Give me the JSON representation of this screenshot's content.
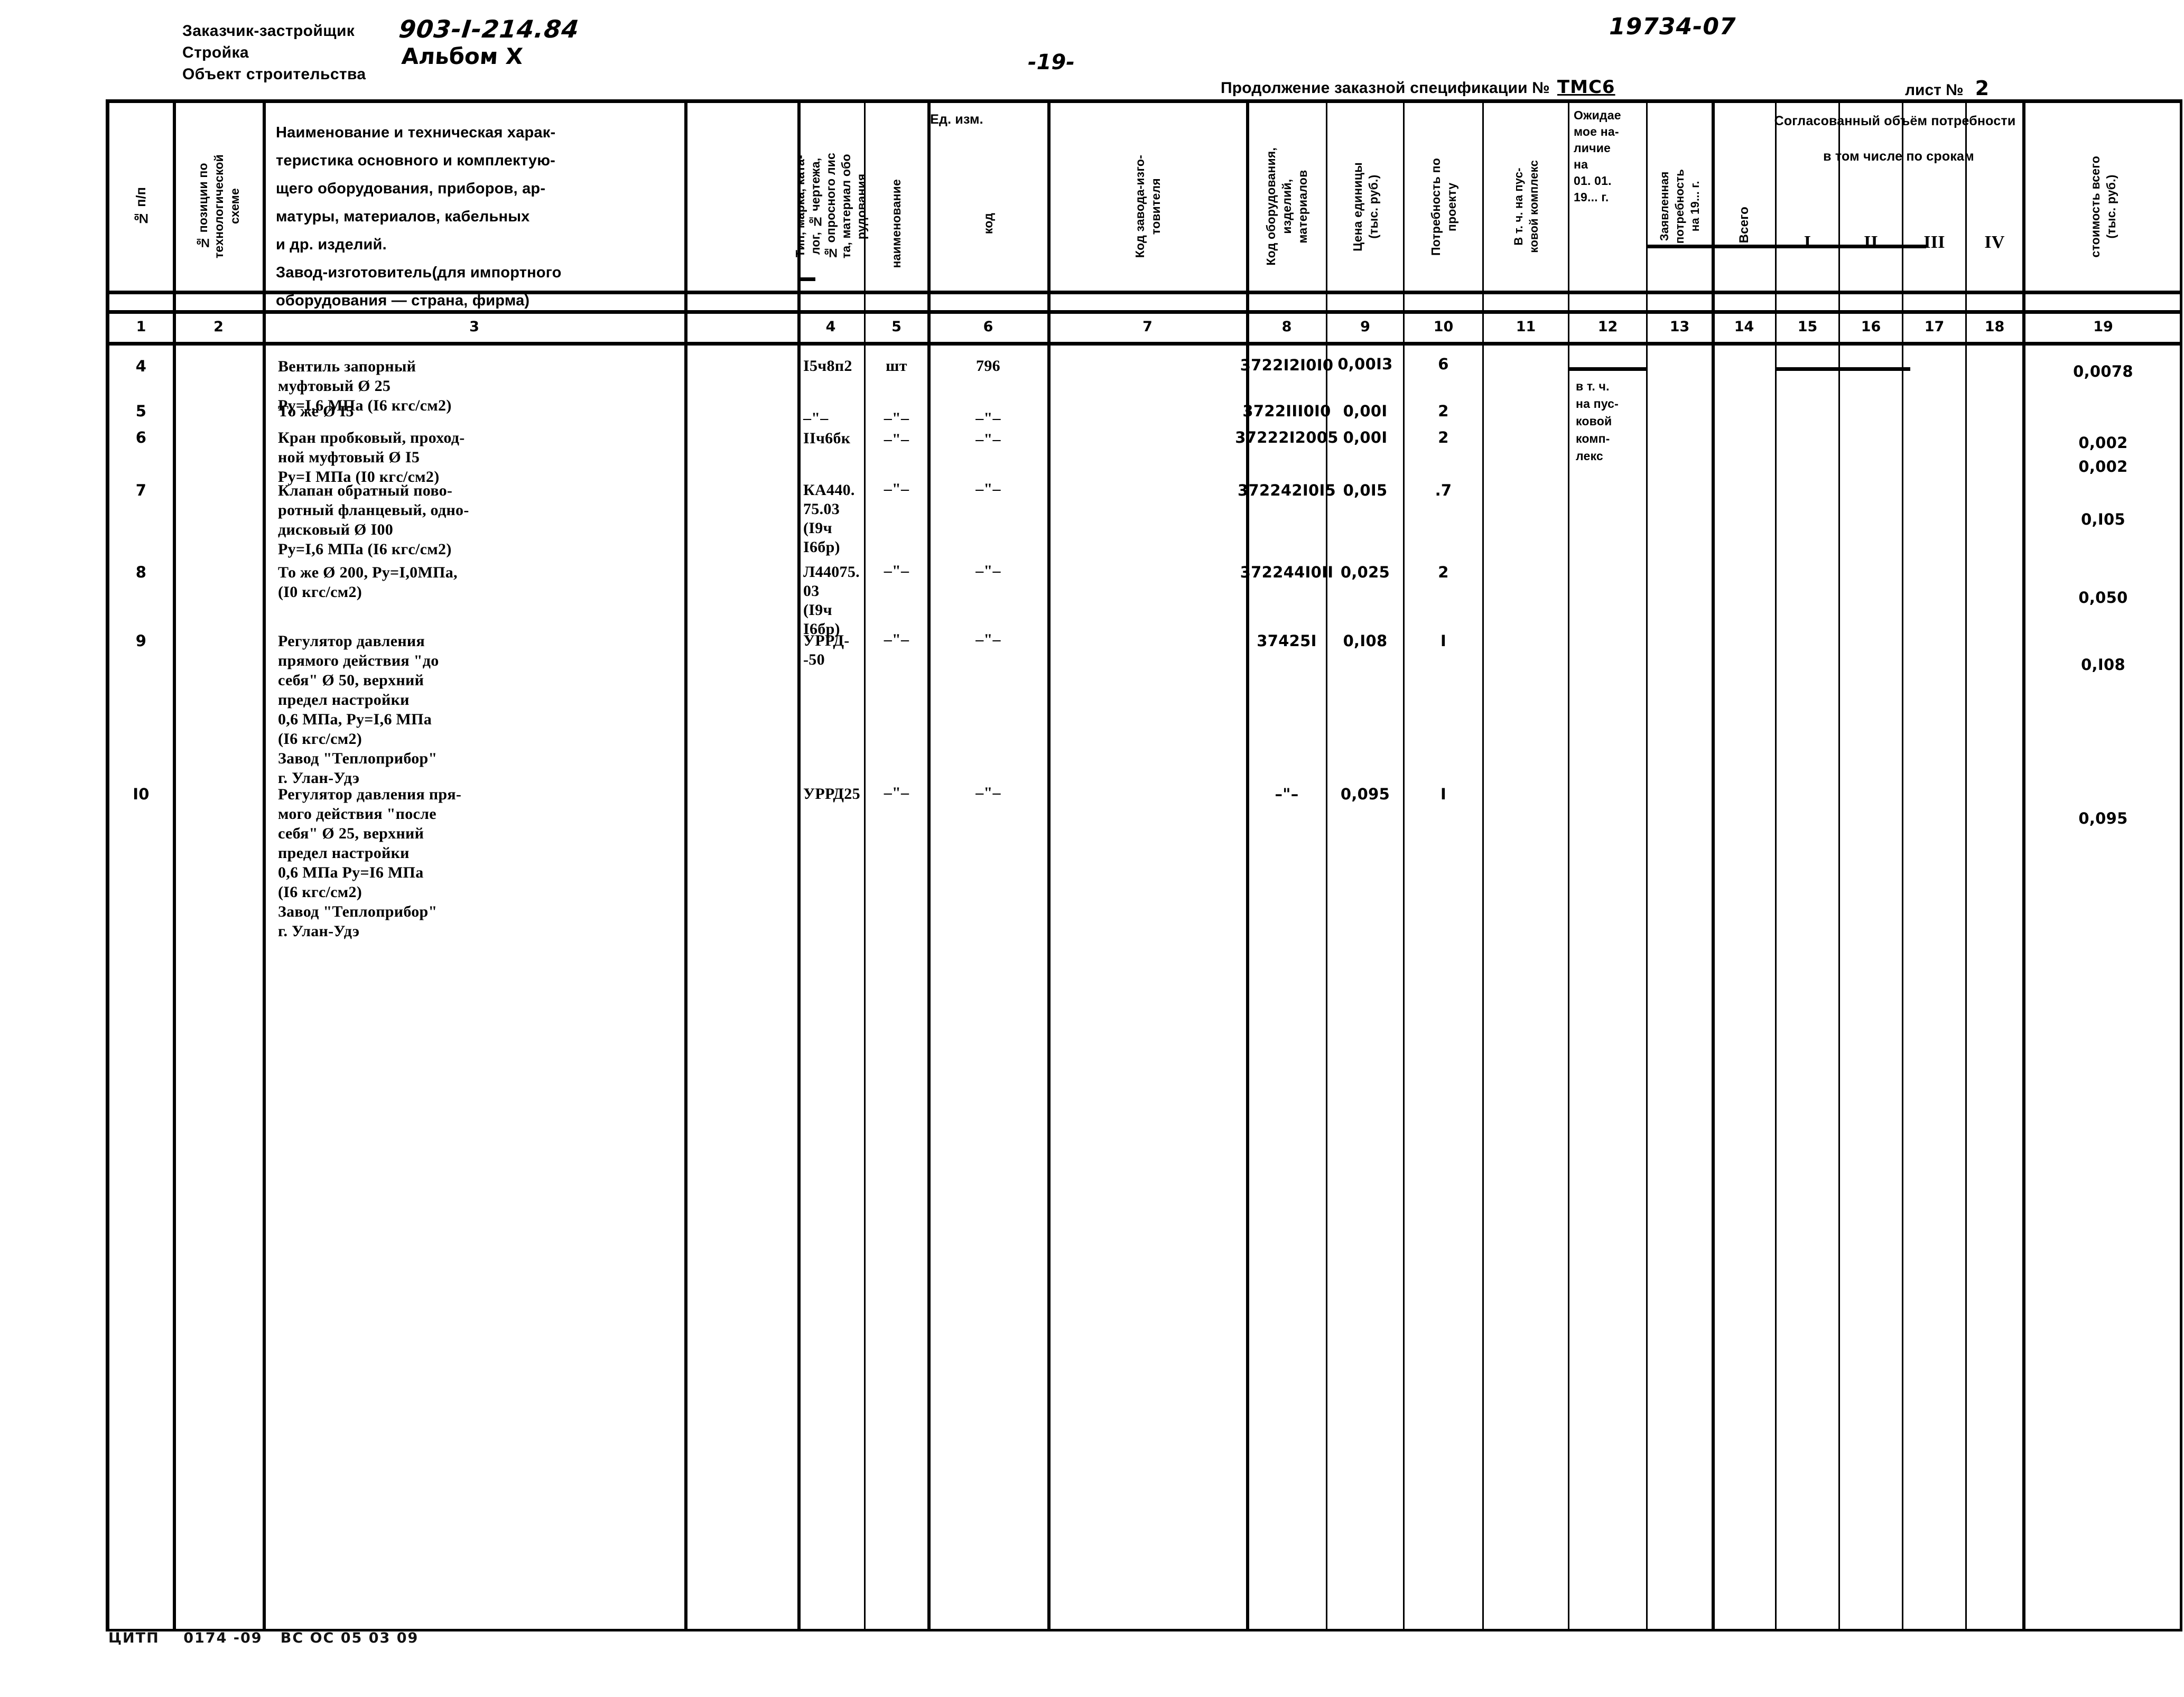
{
  "header": {
    "left_lines": [
      "Заказчик-застройщик",
      "Стройка",
      "Объект строительства"
    ],
    "project_code": "903-I-214.84",
    "album": "Альбом X",
    "page_number": "-19-",
    "order_number": "19734-07",
    "continuation_label": "Продолжение заказной спецификации №",
    "continuation_value": "ТМС6",
    "sheet_label": "лист №",
    "sheet_value": "2"
  },
  "table": {
    "headers": {
      "c1": "№ п/п",
      "c2": "№ позиции по\nтехнологической\nсхеме",
      "c3": "Наименование и техническая харак-\nтеристика основного и комплектую-\nщего оборудования, приборов, ар-\nматуры, материалов, кабельных\nи др. изделий.\nЗавод-изготовитель(для импортного\nоборудования — страна, фирма)",
      "c4": "Тип, марка, ката-\nлог, № чертежа,\n№ опросного лис\nта, материал обо\nрудования",
      "unit_group": "Ед. изм.",
      "c5": "наименование",
      "c6": "код",
      "c7": "Код завода-изго-\nтовителя",
      "c8": "Код оборудования,\nизделий,\nматериалов",
      "c9": "Цена единицы\n(тыс. руб.)",
      "c10": "Потребность по\nпроекту",
      "c11": "В т. ч. на пус-\nковой комплекс",
      "c12": "Ожидае\nмое на-\nличие\nна\n01. 01.\n19... г.",
      "c12b": "в т. ч.\nна пус-\nковой\nкомп-\nлекс",
      "c13": "Заявленная\nпотребность\nна 19... г.",
      "volume_group": "Согласованный объём потребности",
      "c14": "Всего",
      "terms_group": "в том числе по срокам",
      "c15": "I",
      "c16": "II",
      "c17": "III",
      "c18": "IV",
      "c19": "стоимость всего\n(тыс. руб.)"
    },
    "column_numbers": [
      "1",
      "2",
      "3",
      "4",
      "5",
      "6",
      "7",
      "8",
      "9",
      "10",
      "11",
      "12",
      "13",
      "14",
      "15",
      "16",
      "17",
      "18",
      "19"
    ],
    "rows": [
      {
        "c1": "4",
        "c2": "",
        "c3": "Вентиль запорный\nмуфтовый Ø 25\nРу=I,6 МПа (I6 кгс/см2)",
        "c4": "I5ч8п2",
        "c5": "шт",
        "c6": "796",
        "c7": "",
        "c8": "3722I2I0I0",
        "c9": "0,00I3",
        "c10": "6",
        "c11": "",
        "c12": "",
        "c13": "",
        "c14": "",
        "c15": "",
        "c16": "",
        "c17": "",
        "c18": "",
        "c19": "0,0078"
      },
      {
        "c1": "5",
        "c2": "",
        "c3": "То же  Ø I5",
        "c4": "–\"–",
        "c5": "–\"–",
        "c6": "–\"–",
        "c7": "",
        "c8": "3722IІI0I0",
        "c9": "0,00I",
        "c10": "2",
        "c11": "",
        "c12": "",
        "c13": "",
        "c14": "",
        "c15": "",
        "c16": "",
        "c17": "",
        "c18": "",
        "c19": "0,002"
      },
      {
        "c1": "6",
        "c2": "",
        "c3": "Кран пробковый, проход-\nной  муфтовый Ø I5\nРу=I МПа (I0 кгс/см2)",
        "c4": "IIч6бк",
        "c5": "–\"–",
        "c6": "–\"–",
        "c7": "",
        "c8": "37222I2005",
        "c9": "0,00I",
        "c10": "2",
        "c11": "",
        "c12": "",
        "c13": "",
        "c14": "",
        "c15": "",
        "c16": "",
        "c17": "",
        "c18": "",
        "c19": "0,002"
      },
      {
        "c1": "7",
        "c2": "",
        "c3": "Клапан обратный пово-\nротный фланцевый, одно-\nдисковый  Ø I00\nРу=I,6 МПа (I6 кгс/см2)",
        "c4": "КА440.\n75.03\n(I9ч\nI6бр)",
        "c5": "–\"–",
        "c6": "–\"–",
        "c7": "",
        "c8": "372242I0I5",
        "c9": "0,0I5",
        "c10": ".7",
        "c11": "",
        "c12": "",
        "c13": "",
        "c14": "",
        "c15": "",
        "c16": "",
        "c17": "",
        "c18": "",
        "c19": "0,I05"
      },
      {
        "c1": "8",
        "c2": "",
        "c3": "То же Ø 200, Ру=I,0МПа,\n(I0 кгс/см2)",
        "c4": "Л44075.\n03\n(I9ч\nI6бр)",
        "c5": "–\"–",
        "c6": "–\"–",
        "c7": "",
        "c8": "372244I0II",
        "c9": "0,025",
        "c10": "2",
        "c11": "",
        "c12": "",
        "c13": "",
        "c14": "",
        "c15": "",
        "c16": "",
        "c17": "",
        "c18": "",
        "c19": "0,050"
      },
      {
        "c1": "9",
        "c2": "",
        "c3": "Регулятор давления\nпрямого действия \"до\nсебя\" Ø 50, верхний\nпредел настройки\n0,6 МПа, Ру=I,6 МПа\n(I6 кгс/см2)\nЗавод \"Теплоприбор\"\nг. Улан-Удэ",
        "c4": "УРРД-\n-50",
        "c5": "–\"–",
        "c6": "–\"–",
        "c7": "",
        "c8": "37425I",
        "c9": "0,I08",
        "c10": "I",
        "c11": "",
        "c12": "",
        "c13": "",
        "c14": "",
        "c15": "",
        "c16": "",
        "c17": "",
        "c18": "",
        "c19": "0,I08"
      },
      {
        "c1": "I0",
        "c2": "",
        "c3": "Регулятор давления пря-\nмого действия \"после\nсебя\"   Ø 25, верхний\nпредел настройки\n0,6 МПа  Ру=I6 МПа\n(I6 кгс/см2)\nЗавод \"Теплоприбор\"\nг. Улан-Удэ",
        "c4": "УРРД25",
        "c5": "–\"–",
        "c6": "–\"–",
        "c7": "",
        "c8": "–\"–",
        "c9": "0,095",
        "c10": "I",
        "c11": "",
        "c12": "",
        "c13": "",
        "c14": "",
        "c15": "",
        "c16": "",
        "c17": "",
        "c18": "",
        "c19": "0,095"
      }
    ]
  },
  "footer": {
    "text": "ЦИТП    0174 -09   ВС ОС 05 03 09"
  }
}
